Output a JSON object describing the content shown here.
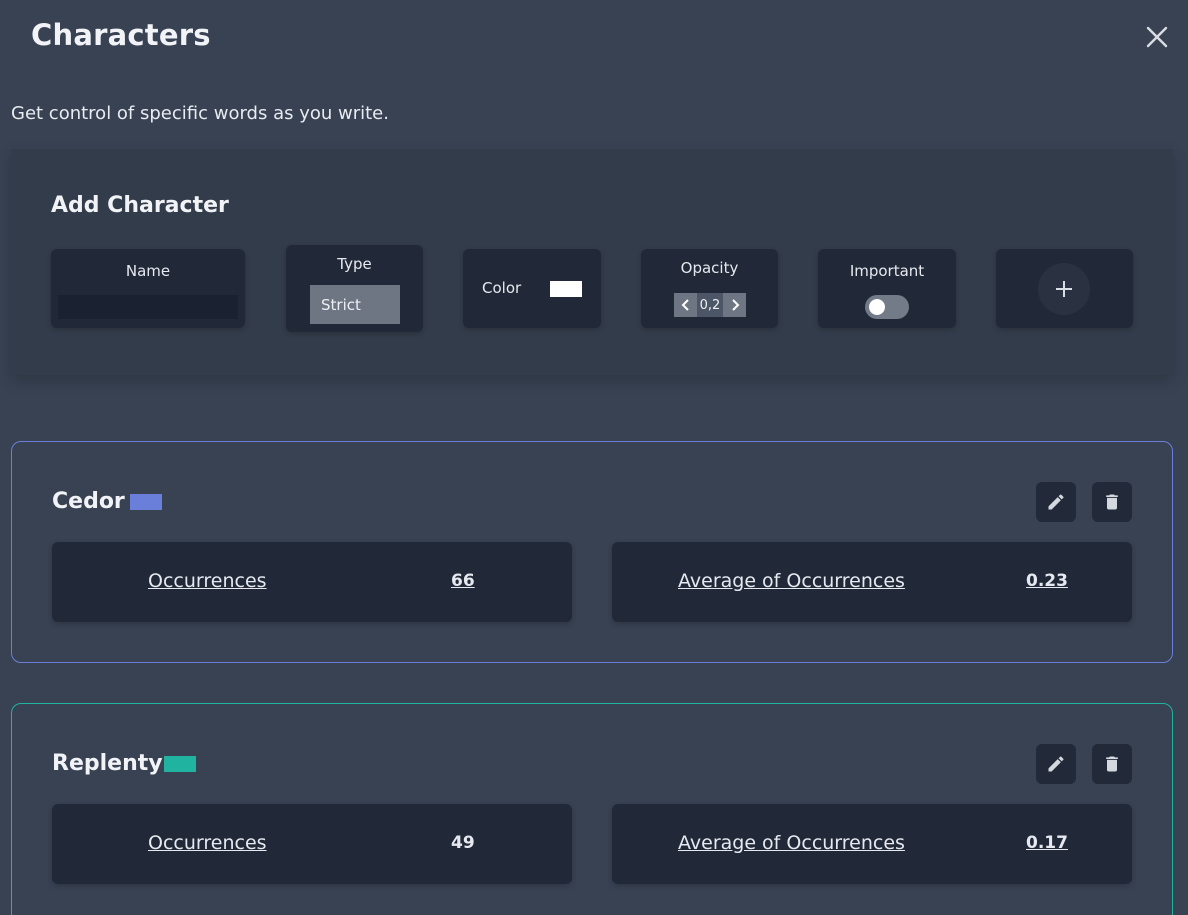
{
  "header": {
    "title": "Characters",
    "close_icon": "close-icon",
    "subtitle": "Get control of specific words as you write."
  },
  "add_character": {
    "title": "Add Character",
    "name": {
      "label": "Name",
      "value": "",
      "placeholder": ""
    },
    "type": {
      "label": "Type",
      "selected": "Strict"
    },
    "color": {
      "label": "Color",
      "value": "#ffffff"
    },
    "opacity": {
      "label": "Opacity",
      "value": "0,2"
    },
    "important": {
      "label": "Important",
      "on": false
    },
    "add_icon": "plus-icon"
  },
  "characters": [
    {
      "name": "Cedor",
      "color": "#6a7fd9",
      "occurrences_label": "Occurrences",
      "occurrences": "66",
      "average_label": "Average of Occurrences",
      "average": "0.23"
    },
    {
      "name": "Replenty",
      "color": "#1fb3a0",
      "occurrences_label": "Occurrences",
      "occurrences": "49",
      "average_label": "Average of Occurrences",
      "average": "0.17"
    }
  ],
  "icons": {
    "edit": "pencil-icon",
    "delete": "trash-icon"
  }
}
